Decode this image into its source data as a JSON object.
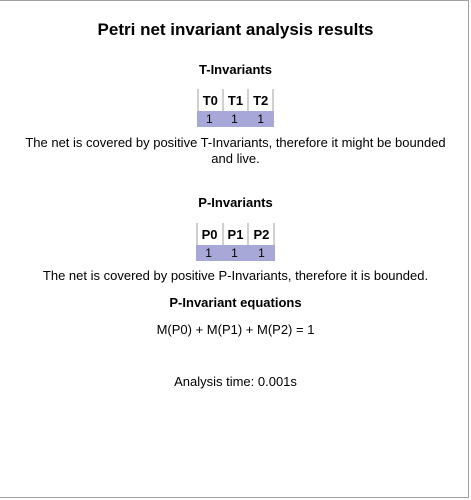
{
  "title": "Petri net invariant analysis results",
  "t_invariants": {
    "heading": "T-Invariants",
    "columns": [
      "T0",
      "T1",
      "T2"
    ],
    "values": [
      "1",
      "1",
      "1"
    ],
    "message_line1": "The net is covered by positive T-Invariants, therefore it might be bounded",
    "message_line2": "and live."
  },
  "p_invariants": {
    "heading": "P-Invariants",
    "columns": [
      "P0",
      "P1",
      "P2"
    ],
    "values": [
      "1",
      "1",
      "1"
    ],
    "message": "The net is covered by positive P-Invariants, therefore it is bounded."
  },
  "p_equations": {
    "heading": "P-Invariant equations",
    "equation": "M(P0) + M(P1) + M(P2) = 1"
  },
  "analysis_time": "Analysis time: 0.001s",
  "colors": {
    "value_row_bg": "#a8a8d8",
    "header_divider": "#d0d0d0"
  }
}
